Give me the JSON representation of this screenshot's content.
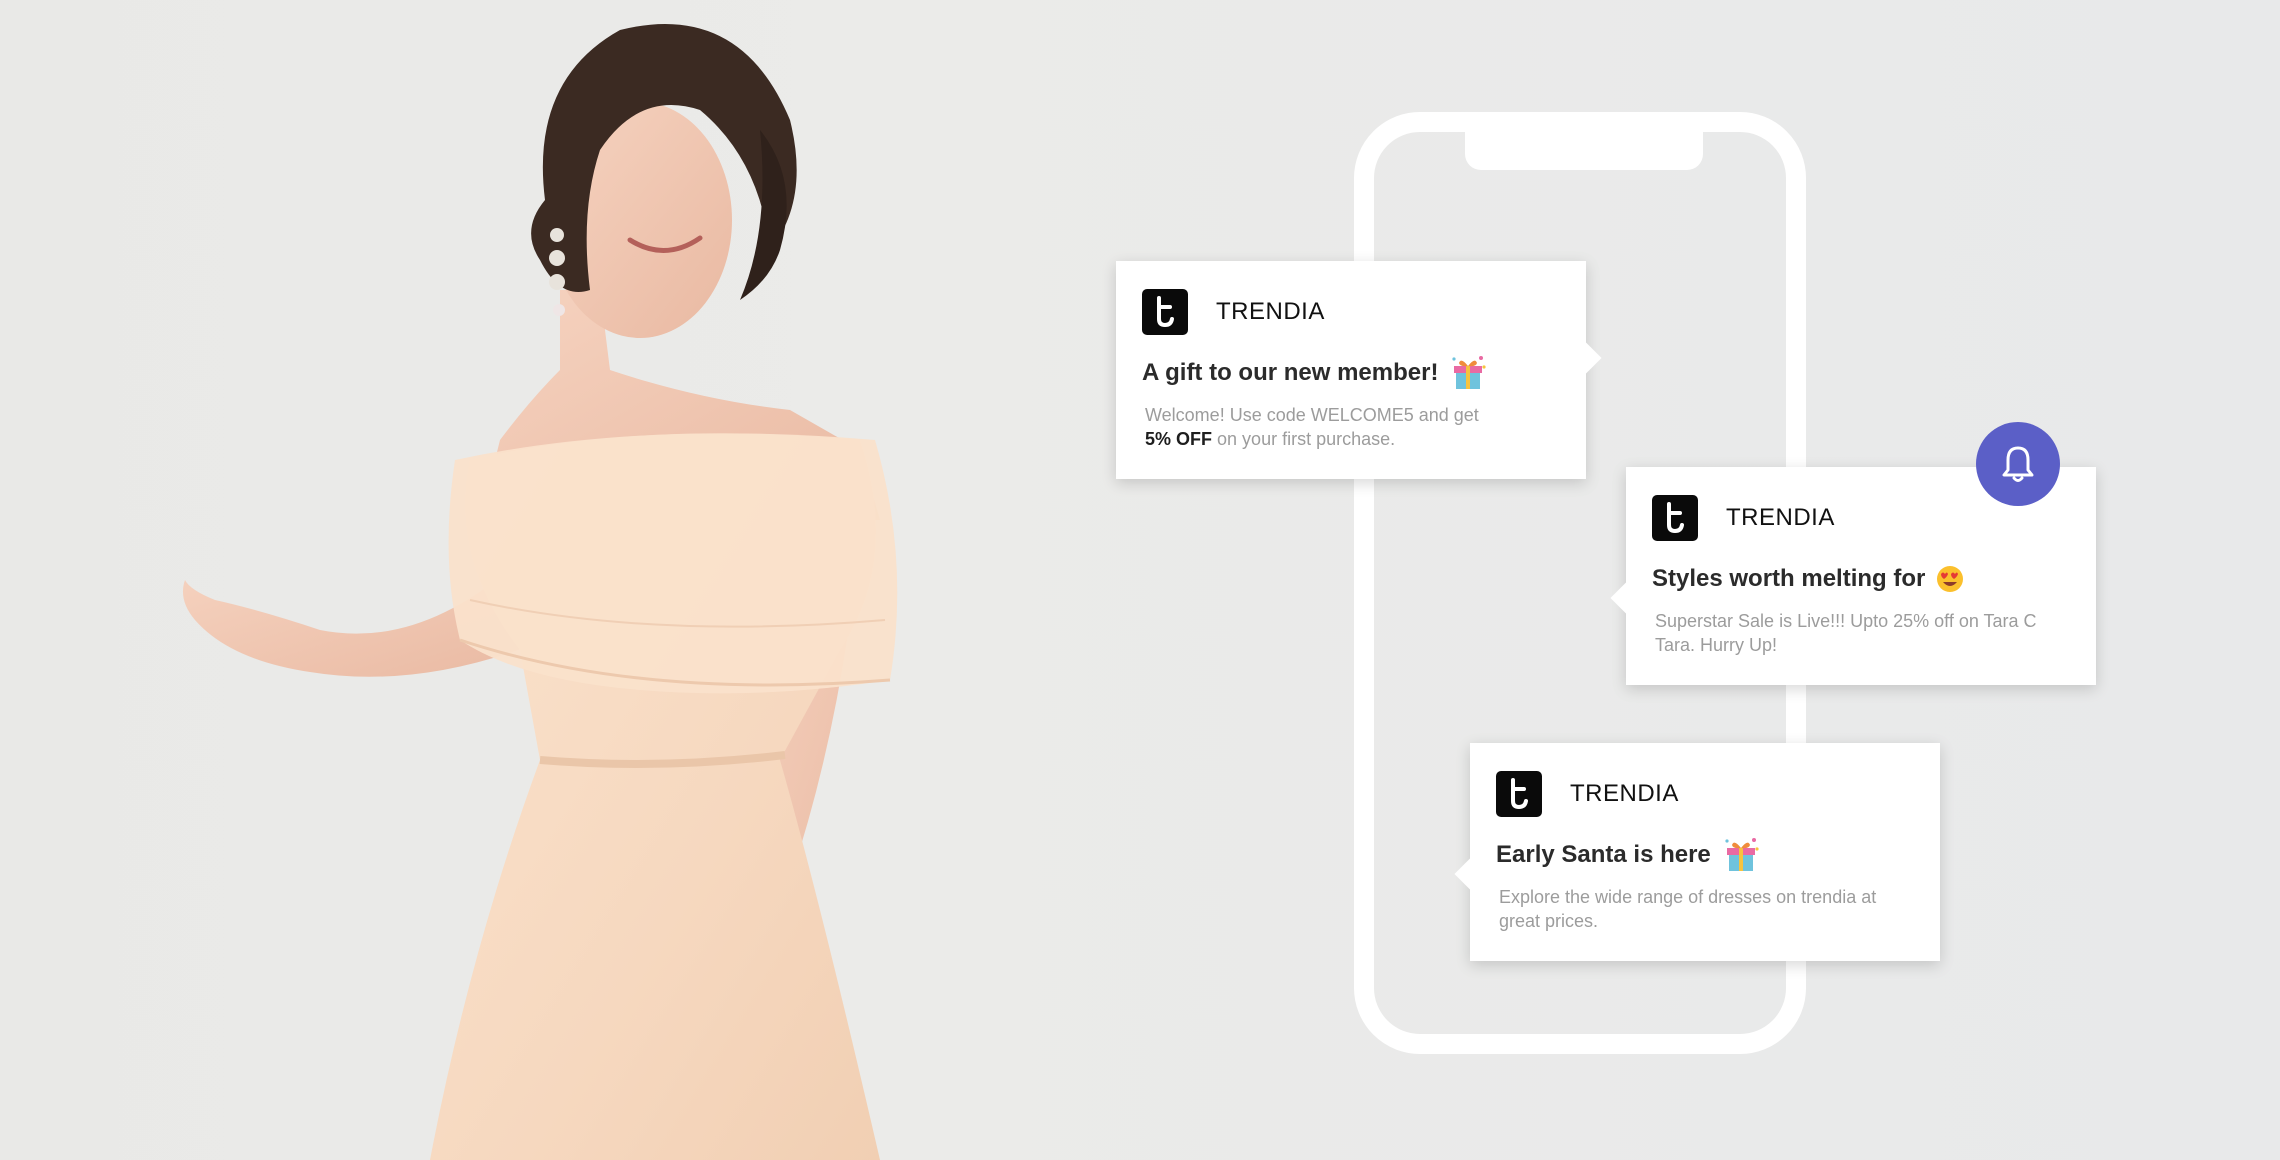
{
  "brand": {
    "app_name": "TRENDIA",
    "logo_letter": "t"
  },
  "notifications": [
    {
      "app_name": "TRENDIA",
      "title": "A gift to our new member!",
      "title_icon": "gift-icon",
      "body_lead": "Welcome! Use code WELCOME5 and get",
      "body_emphasis": "5% OFF",
      "body_tail": "on your first purchase."
    },
    {
      "app_name": "TRENDIA",
      "title": "Styles worth melting for",
      "title_icon": "heart-eyes-emoji-icon",
      "body": "Superstar Sale is Live!!! Upto 25% off on Tara C Tara. Hurry Up!"
    },
    {
      "app_name": "TRENDIA",
      "title": "Early Santa is here",
      "title_icon": "gift-icon",
      "body": "Explore the wide range of dresses on trendia at great prices."
    }
  ],
  "badge": {
    "icon": "bell-icon",
    "color": "#5b5fc7"
  },
  "colors": {
    "background": "#ebebe9",
    "dress": "#f8dcc4",
    "card": "#ffffff",
    "logo_bg": "#0a0a0a"
  }
}
